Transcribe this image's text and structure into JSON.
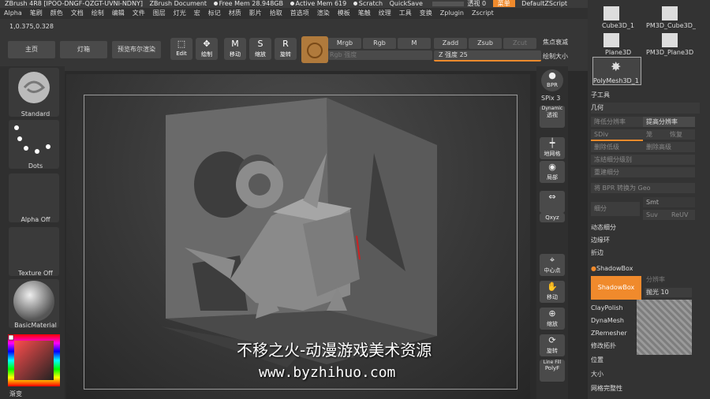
{
  "titlebar": {
    "app": "ZBrush 4R8 [IPOO-DNGF-QZGT-UVNI-NDNY]",
    "doc": "ZBrush Document",
    "free_mem": "Free Mem 28.948GB",
    "active_mem": "Active Mem 619",
    "scratch": "Scratch",
    "quicksave": "QuickSave",
    "transparency": "透视 0",
    "menu": "菜单",
    "script": "DefaultZScript"
  },
  "menubar": [
    "Alpha",
    "笔刷",
    "颜色",
    "文档",
    "绘制",
    "编辑",
    "文件",
    "图层",
    "灯光",
    "宏",
    "标记",
    "材质",
    "影片",
    "拾取",
    "首选项",
    "渲染",
    "模板",
    "笔触",
    "纹理",
    "工具",
    "变换",
    "Zplugin",
    "Zscript"
  ],
  "coords": "1,0.375,0.328",
  "toolbar": {
    "home": "主页",
    "lightbox": "灯箱",
    "preview_render": "预览布尔渲染",
    "edit": "Edit",
    "draw": "绘制",
    "move": "移动",
    "scale": "缩放",
    "rotate": "旋转",
    "mrgb": "Mrgb",
    "rgb": "Rgb",
    "m": "M",
    "zadd": "Zadd",
    "zsub": "Zsub",
    "zcut": "Zcut",
    "rgb_intensity": "Rgb 强度",
    "z_intensity": "Z 强度 25",
    "focal": "焦点衰减",
    "draw_size": "绘制大小"
  },
  "leftshelf": {
    "brush": "Standard",
    "stroke": "Dots",
    "alpha": "Alpha Off",
    "texture": "Texture Off",
    "material": "BasicMaterial",
    "gradient": "渐变"
  },
  "rightshelf": {
    "bpr": "BPR",
    "spix": "SPix 3",
    "dynamic": "Dynamic",
    "perspective": "透视",
    "floor": "地网格",
    "solo": "局部",
    "xyz": "Qxyz",
    "center": "中心点",
    "move": "移动",
    "scale": "缩放",
    "rotate": "旋转",
    "linefill": "Line Fill",
    "polyf": "PolyF"
  },
  "panel": {
    "tools": [
      "Cube3D_1",
      "PM3D_Cube3D_",
      "Plane3D",
      "PM3D_Plane3D",
      "PolyMesh3D_1"
    ],
    "subtool": "子工具",
    "geometry": "几何",
    "lower_res": "降低分辨率",
    "higher_res": "提高分辨率",
    "sdiv": "SDiv",
    "cage": "笼",
    "restore": "恢复",
    "del_lower": "删除低级",
    "del_higher": "删除高级",
    "freeze": "冻结细分级别",
    "reconstruct": "重建细分",
    "convert_bpr": "将 BPR 转换为 Geo",
    "divide": "细分",
    "smt": "Smt",
    "suv": "Suv",
    "reuv": "ReUV",
    "dynamic_sub": "动态细分",
    "edge_loop": "边缘环",
    "crease": "折边",
    "shadowbox_title": "ShadowBox",
    "shadowbox_btn": "ShadowBox",
    "resolution": "分辨率",
    "polish": "抛光 10",
    "claypolish": "ClayPolish",
    "dynamesh": "DynaMesh",
    "zremesher": "ZRemesher",
    "modify_topo": "修改拓扑",
    "position": "位置",
    "size": "大小",
    "mesh_integrity": "网格完整性"
  },
  "watermark": {
    "line1": "不移之火-动漫游戏美术资源",
    "line2": "www.byzhihuo.com"
  },
  "colors": {
    "accent": "#f08a2c",
    "canvas": "#3a3a3a",
    "panel": "#333333"
  }
}
